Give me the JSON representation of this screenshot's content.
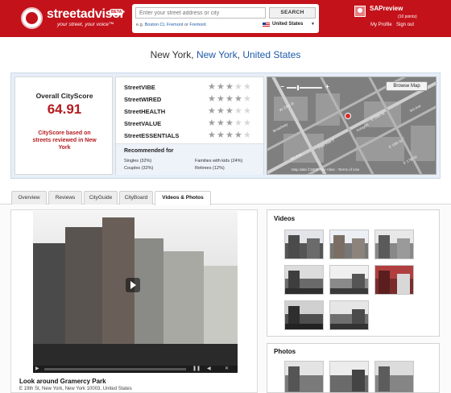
{
  "header": {
    "brand": "streetadvisor",
    "beta": "BETA",
    "tagline": "your street, your voice™",
    "search_placeholder": "Enter your street address or city",
    "search_button": "SEARCH",
    "eg_prefix": "e.g.",
    "eg_link1": "Boston Ct, Fremont",
    "eg_or": "or",
    "eg_link2": "Fremont",
    "country": "United States",
    "country_arrow": "▼",
    "username": "SAPreview",
    "points": "(10 points)",
    "my_profile": "My Profile",
    "sign_out": "Sign out"
  },
  "location": {
    "city": "New York",
    "sep1": ", ",
    "state": "New York",
    "sep2": ", ",
    "country": "United States"
  },
  "cityscore": {
    "title": "Overall CityScore",
    "value": "64.91",
    "description": "CityScore based on streets reviewed in New York"
  },
  "ratings": [
    {
      "label": "StreetVIBE",
      "stars": 3
    },
    {
      "label": "StreetWIRED",
      "stars": 4
    },
    {
      "label": "StreetHEALTH",
      "stars": 3
    },
    {
      "label": "StreetVALUE",
      "stars": 3
    },
    {
      "label": "StreetESSENTIALS",
      "stars": 4
    }
  ],
  "recommended": {
    "title": "Recommended for",
    "items": [
      "Singles (32%)",
      "Families with kids (24%)",
      "Couples (32%)",
      "Retirees (12%)"
    ]
  },
  "map": {
    "browse_button": "Browse Map",
    "credit": "Map data ©2009 Tele Atlas · Terms of Use",
    "street_labels": [
      "W 23rd St",
      "Park Ave S",
      "E 20th St",
      "Broadway",
      "5th Ave",
      "E 18th St",
      "Irving Pl",
      "E 17th St",
      "3rd Ave"
    ],
    "zoom_minus": "−",
    "zoom_plus": "+"
  },
  "tabs": [
    "Overview",
    "Reviews",
    "CityGuide",
    "CityBoard",
    "Videos & Photos"
  ],
  "active_tab": "Videos & Photos",
  "video": {
    "title": "Look around Gramercy Park",
    "address": "E 19th St, New York, New York 10003, United States",
    "controls": {
      "play": "▶",
      "pause": "❚❚",
      "volume": "◀",
      "close": "✕"
    }
  },
  "sidebar": {
    "videos_title": "Videos",
    "photos_title": "Photos"
  },
  "colors": {
    "brand_red": "#c3121a",
    "score_red": "#b31c20",
    "link_blue": "#1e5aa8",
    "panel_blue": "#e6eef8"
  }
}
